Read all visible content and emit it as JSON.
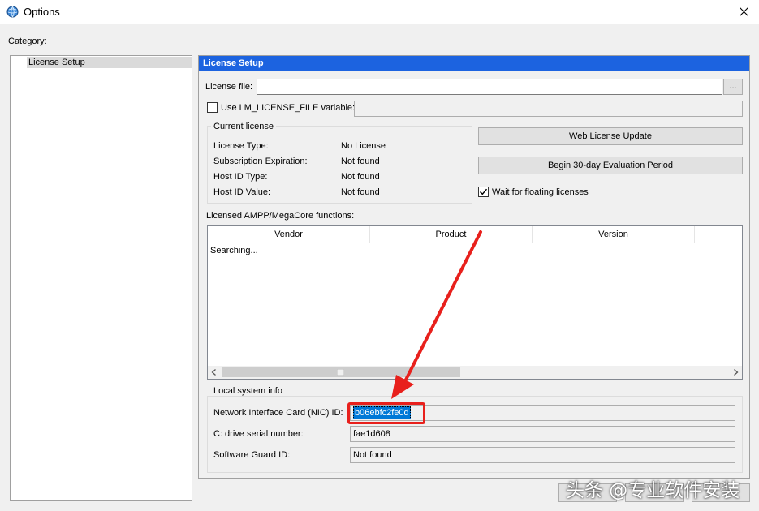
{
  "window": {
    "title": "Options"
  },
  "category": {
    "label": "Category:",
    "items": [
      "License Setup"
    ]
  },
  "panel": {
    "header": "License Setup",
    "license_file": {
      "label": "License file:",
      "value": "",
      "browse_label": "..."
    },
    "lm_license": {
      "label": "Use LM_LICENSE_FILE variable:",
      "checked": false,
      "value": ""
    },
    "current_license": {
      "title": "Current license",
      "rows": [
        {
          "label": "License Type:",
          "value": "No License"
        },
        {
          "label": "Subscription Expiration:",
          "value": "Not found"
        },
        {
          "label": "Host ID Type:",
          "value": "Not found"
        },
        {
          "label": "Host ID Value:",
          "value": "Not found"
        }
      ]
    },
    "web_update_label": "Web License Update",
    "evaluation_label": "Begin 30-day Evaluation Period",
    "wait_floating": {
      "label": "Wait for floating licenses",
      "checked": true
    },
    "functions": {
      "label": "Licensed AMPP/MegaCore functions:",
      "columns": [
        "Vendor",
        "Product",
        "Version"
      ],
      "status": "Searching..."
    },
    "local_info": {
      "title": "Local system info",
      "nic": {
        "label": "Network Interface Card (NIC) ID:",
        "value": "b06ebfc2fe0d"
      },
      "drive": {
        "label": "C: drive serial number:",
        "value": "fae1d608"
      },
      "guard": {
        "label": "Software Guard ID:",
        "value": "Not found"
      }
    }
  },
  "watermark": "头条 @专业软件安装",
  "colors": {
    "header_blue": "#1c63e0",
    "annotation_red": "#e8201c",
    "selection_blue": "#0078d7"
  }
}
